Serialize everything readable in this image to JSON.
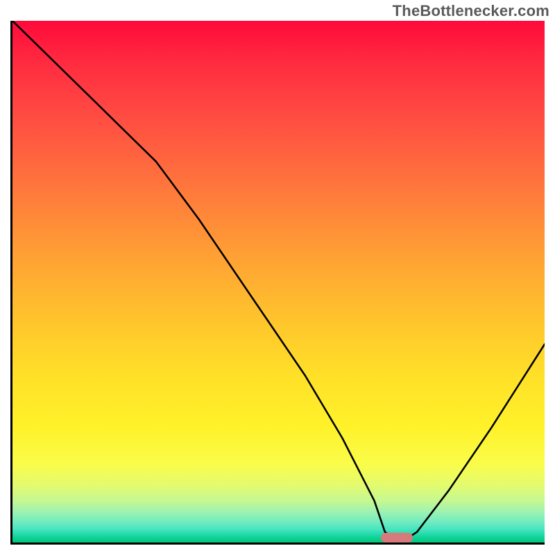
{
  "watermark": {
    "text": "TheBottlenecker.com"
  },
  "chart_data": {
    "type": "line",
    "title": "",
    "xlabel": "",
    "ylabel": "",
    "xlim": [
      0,
      100
    ],
    "ylim": [
      0,
      100
    ],
    "x": [
      0,
      10,
      20,
      27,
      35,
      45,
      55,
      62,
      68,
      70,
      73,
      76,
      82,
      90,
      100
    ],
    "values": [
      100,
      90,
      80,
      73,
      62,
      47,
      32,
      20,
      8,
      2,
      0,
      2,
      10,
      22,
      38
    ],
    "optimum_marker": {
      "x": 72,
      "width_pct": 6
    },
    "background_gradient": {
      "stops": [
        {
          "pct": 0,
          "color": "#ff0a3a"
        },
        {
          "pct": 50,
          "color": "#ffb030"
        },
        {
          "pct": 80,
          "color": "#fff22a"
        },
        {
          "pct": 100,
          "color": "#00c878"
        }
      ]
    }
  }
}
